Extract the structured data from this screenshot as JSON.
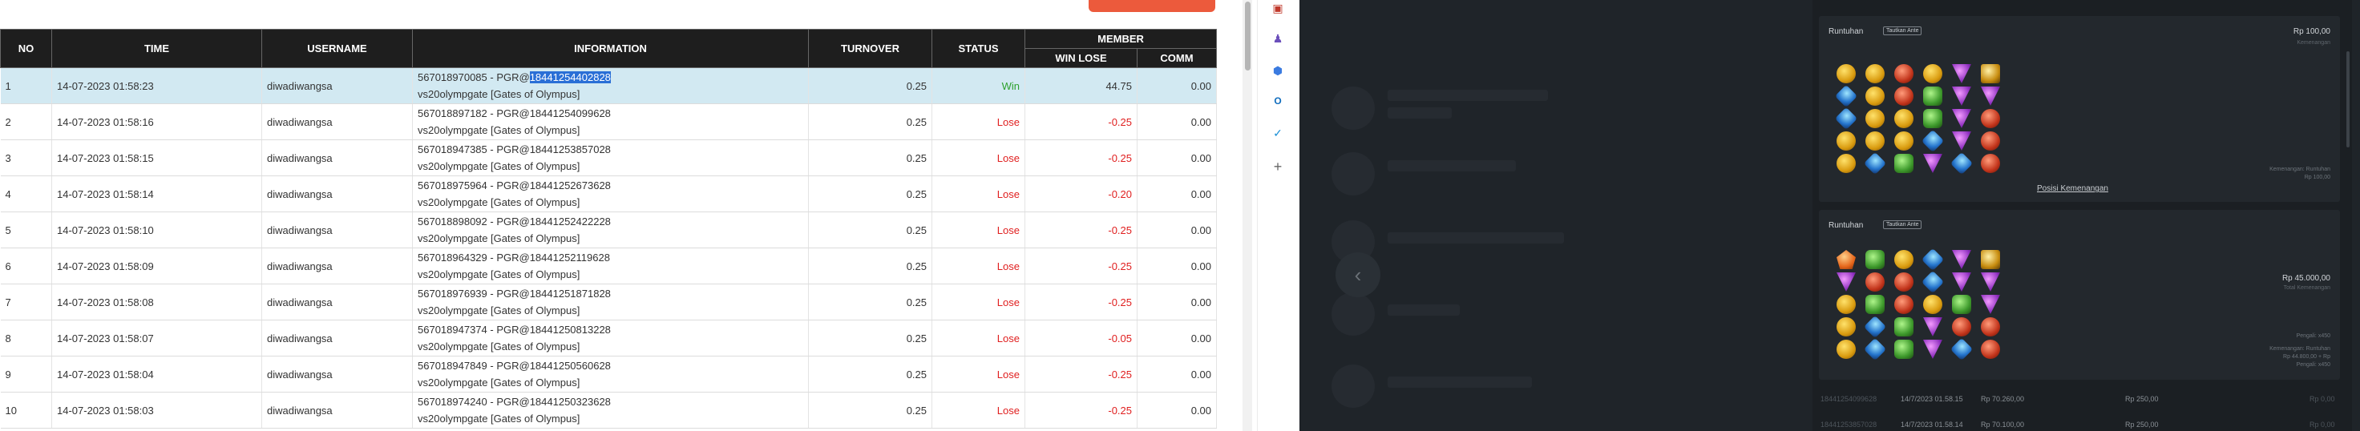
{
  "table": {
    "headers": {
      "no": "NO",
      "time": "TIME",
      "username": "USERNAME",
      "information": "INFORMATION",
      "turnover": "TURNOVER",
      "status": "STATUS",
      "member": "MEMBER",
      "winlose": "WIN LOSE",
      "comm": "COMM"
    },
    "rows": [
      {
        "no": "1",
        "time": "14-07-2023 01:58:23",
        "username": "diwadiwangsa",
        "info_prefix": "567018970085 - PGR@",
        "info_id": "18441254402828",
        "info_game": "vs20olympgate [Gates of Olympus]",
        "turnover": "0.25",
        "status": "Win",
        "winlose": "44.75",
        "comm": "0.00"
      },
      {
        "no": "2",
        "time": "14-07-2023 01:58:16",
        "username": "diwadiwangsa",
        "info_prefix": "567018897182 - PGR@",
        "info_id": "18441254099628",
        "info_game": "vs20olympgate [Gates of Olympus]",
        "turnover": "0.25",
        "status": "Lose",
        "winlose": "-0.25",
        "comm": "0.00"
      },
      {
        "no": "3",
        "time": "14-07-2023 01:58:15",
        "username": "diwadiwangsa",
        "info_prefix": "567018947385 - PGR@",
        "info_id": "18441253857028",
        "info_game": "vs20olympgate [Gates of Olympus]",
        "turnover": "0.25",
        "status": "Lose",
        "winlose": "-0.25",
        "comm": "0.00"
      },
      {
        "no": "4",
        "time": "14-07-2023 01:58:14",
        "username": "diwadiwangsa",
        "info_prefix": "567018975964 - PGR@",
        "info_id": "18441252673628",
        "info_game": "vs20olympgate [Gates of Olympus]",
        "turnover": "0.25",
        "status": "Lose",
        "winlose": "-0.20",
        "comm": "0.00"
      },
      {
        "no": "5",
        "time": "14-07-2023 01:58:10",
        "username": "diwadiwangsa",
        "info_prefix": "567018898092 - PGR@",
        "info_id": "18441252422228",
        "info_game": "vs20olympgate [Gates of Olympus]",
        "turnover": "0.25",
        "status": "Lose",
        "winlose": "-0.25",
        "comm": "0.00"
      },
      {
        "no": "6",
        "time": "14-07-2023 01:58:09",
        "username": "diwadiwangsa",
        "info_prefix": "567018964329 - PGR@",
        "info_id": "18441252119628",
        "info_game": "vs20olympgate [Gates of Olympus]",
        "turnover": "0.25",
        "status": "Lose",
        "winlose": "-0.25",
        "comm": "0.00"
      },
      {
        "no": "7",
        "time": "14-07-2023 01:58:08",
        "username": "diwadiwangsa",
        "info_prefix": "567018976939 - PGR@",
        "info_id": "18441251871828",
        "info_game": "vs20olympgate [Gates of Olympus]",
        "turnover": "0.25",
        "status": "Lose",
        "winlose": "-0.25",
        "comm": "0.00"
      },
      {
        "no": "8",
        "time": "14-07-2023 01:58:07",
        "username": "diwadiwangsa",
        "info_prefix": "567018947374 - PGR@",
        "info_id": "18441250813228",
        "info_game": "vs20olympgate [Gates of Olympus]",
        "turnover": "0.25",
        "status": "Lose",
        "winlose": "-0.05",
        "comm": "0.00"
      },
      {
        "no": "9",
        "time": "14-07-2023 01:58:04",
        "username": "diwadiwangsa",
        "info_prefix": "567018947849 - PGR@",
        "info_id": "18441250560628",
        "info_game": "vs20olympgate [Gates of Olympus]",
        "turnover": "0.25",
        "status": "Lose",
        "winlose": "-0.25",
        "comm": "0.00"
      },
      {
        "no": "10",
        "time": "14-07-2023 01:58:03",
        "username": "diwadiwangsa",
        "info_prefix": "567018974240 - PGR@",
        "info_id": "18441250323628",
        "info_game": "vs20olympgate [Gates of Olympus]",
        "turnover": "0.25",
        "status": "Lose",
        "winlose": "-0.25",
        "comm": "0.00"
      }
    ]
  },
  "colors": {
    "win": "#2ea12e",
    "lose": "#e02020",
    "selected_row": "#d2e9f2",
    "header_bg": "#1e1e1e",
    "dark_bg": "#1f2429"
  },
  "side_icons": [
    "toolbox-icon",
    "people-icon",
    "copilot-icon",
    "outlook-icon",
    "shopping-icon",
    "plus-icon"
  ],
  "details": {
    "card1": {
      "title": "Runtuhan",
      "badge": "Tautkan Ante",
      "amount": "Rp 100,00",
      "sub": "Kemenangan",
      "note1": "Kemenangan: Runtuhan",
      "note2": "Rp 100,00",
      "link": "Posisi Kemenangan"
    },
    "card2": {
      "title": "Runtuhan",
      "badge": "Tautkan Ante",
      "amount": "Rp 45.000,00",
      "sub": "Total Kemenangan",
      "note1": "Pengali: x450",
      "note2": "Kemenangan: Runtuhan",
      "note3": "Rp 44.800,00 + Rp",
      "note4": "Pengali: x450"
    },
    "history": [
      {
        "id": "18441254099628",
        "time": "14/7/2023 01.58.15",
        "a": "Rp 70.260,00",
        "b": "Rp 250,00",
        "c": "Rp 0,00"
      },
      {
        "id": "18441253857028",
        "time": "14/7/2023 01.58.14",
        "a": "Rp 70.100,00",
        "b": "Rp 250,00",
        "c": "Rp 0,00"
      }
    ]
  }
}
